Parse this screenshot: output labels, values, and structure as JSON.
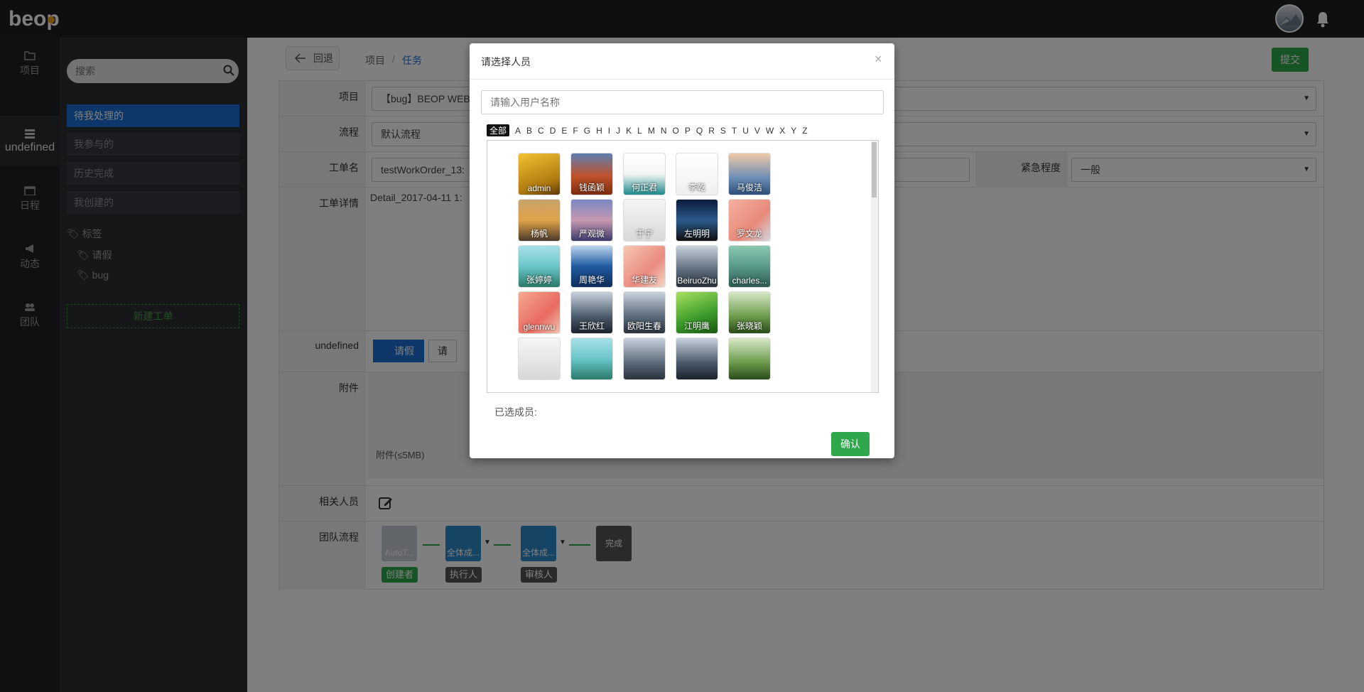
{
  "app": {
    "logo_text": "beop"
  },
  "rail": [
    {
      "label": "项目",
      "icon": "folder-icon"
    },
    {
      "label": "undefined",
      "icon": "list-icon"
    },
    {
      "label": "日程",
      "icon": "calendar-icon"
    },
    {
      "label": "动态",
      "icon": "bullhorn-icon"
    },
    {
      "label": "团队",
      "icon": "team-icon"
    }
  ],
  "sidebar": {
    "search_placeholder": "搜索",
    "items": [
      "待我处理的",
      "我参与的",
      "历史完成",
      "我创建的"
    ],
    "tags_header": "标签",
    "tags": [
      "请假",
      "bug"
    ],
    "new_button": "新建工单"
  },
  "main": {
    "back_label": "回退",
    "breadcrumb": [
      "项目",
      "/",
      "任务"
    ],
    "submit_label": "提交",
    "labels": {
      "project": "项目",
      "flow": "流程",
      "name": "工单名",
      "urgency": "紧急程度",
      "detail": "工单详情",
      "tags": "undefined",
      "attachment": "附件",
      "related": "相关人员",
      "team_flow": "团队流程"
    },
    "project_value": "【bug】BEOP WEB",
    "flow_value": "默认流程",
    "name_value": "testWorkOrder_13:",
    "urgency_value": "一般",
    "detail_value": "Detail_2017-04-11 1:",
    "tag_chip": "请假",
    "tag_chip2": "请假",
    "attachment_hint": "附件(≤5MB)",
    "flow_nodes": [
      {
        "name": "AutoT...",
        "role": "创建者"
      },
      {
        "name": "全体成...",
        "role": "执行人"
      },
      {
        "name": "全体成...",
        "role": "审核人"
      },
      {
        "name": "完成"
      }
    ]
  },
  "modal": {
    "title": "请选择人员",
    "close": "×",
    "search_placeholder": "请输入用户名称",
    "letters": [
      "全部",
      "A",
      "B",
      "C",
      "D",
      "E",
      "F",
      "G",
      "H",
      "I",
      "J",
      "K",
      "L",
      "M",
      "N",
      "O",
      "P",
      "Q",
      "R",
      "S",
      "T",
      "U",
      "V",
      "W",
      "X",
      "Y",
      "Z"
    ],
    "users": [
      "admin",
      "钱函颖",
      "何正君",
      "李乾",
      "马俊洁",
      "杨帆",
      "严观微",
      "于宁",
      "左明明",
      "罗文龙",
      "张婷婷",
      "周艳华",
      "华建友",
      "BeiruoZhu",
      "charles...",
      "glennwu",
      "王欣红",
      "欧阳生春",
      "江明鹰",
      "张晓颖"
    ],
    "selected_label": "已选成员:",
    "confirm": "确认"
  }
}
